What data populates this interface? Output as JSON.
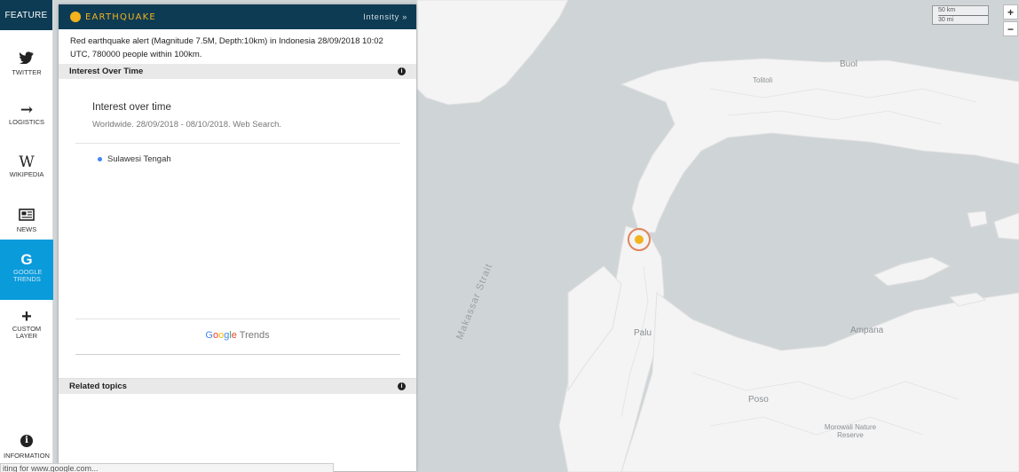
{
  "map": {
    "labels": {
      "buol": "Buol",
      "tolitoli": "Tolitoli",
      "palu": "Palu",
      "ampana": "Ampana",
      "poso": "Poso",
      "strait": "Makassar Strait",
      "reserve": "Morowali Nature Reserve"
    },
    "scale": {
      "km": "50 km",
      "mi": "30 mi"
    },
    "zoom": {
      "in": "+",
      "out": "−"
    }
  },
  "feature_bar": {
    "header": "FEATURE",
    "items": [
      {
        "label": "TWITTER",
        "icon": "twitter-icon",
        "glyph": "🐦"
      },
      {
        "label": "LOGISTICS",
        "icon": "arrow-right-icon",
        "glyph": "→"
      },
      {
        "label": "WIKIPEDIA",
        "icon": "wikipedia-icon",
        "glyph": "W"
      },
      {
        "label": "NEWS",
        "icon": "newspaper-icon",
        "glyph": "▤"
      },
      {
        "label": "GOOGLE TRENDS",
        "icon": "google-icon",
        "glyph": "G"
      },
      {
        "label": "CUSTOM LAYER",
        "icon": "plus-icon",
        "glyph": "+"
      },
      {
        "label": "INFORMATION",
        "icon": "info-icon",
        "glyph": "i"
      }
    ]
  },
  "panel": {
    "title": "EARTHQUAKE",
    "intensity_label": "Intensity »",
    "alert": "Red earthquake alert (Magnitude 7.5M, Depth:10km) in Indonesia 28/09/2018 10:02 UTC, 780000 people within 100km.",
    "sections": {
      "interest": "Interest Over Time",
      "related": "Related topics"
    },
    "trends": {
      "title": "Interest over time",
      "subtitle": "Worldwide. 28/09/2018 - 08/10/2018. Web Search.",
      "legend_item": "Sulawesi Tengah",
      "logo_google": [
        "G",
        "o",
        "o",
        "g",
        "l",
        "e"
      ],
      "logo_trends": " Trends"
    },
    "info_glyph": "i"
  },
  "status_bar": "iting for www.google.com...",
  "colors": {
    "header_bg": "#0d3b54",
    "accent_yellow": "#f2b31c",
    "active_blue": "#0a9bdb",
    "quake_ring": "#e0835b"
  }
}
